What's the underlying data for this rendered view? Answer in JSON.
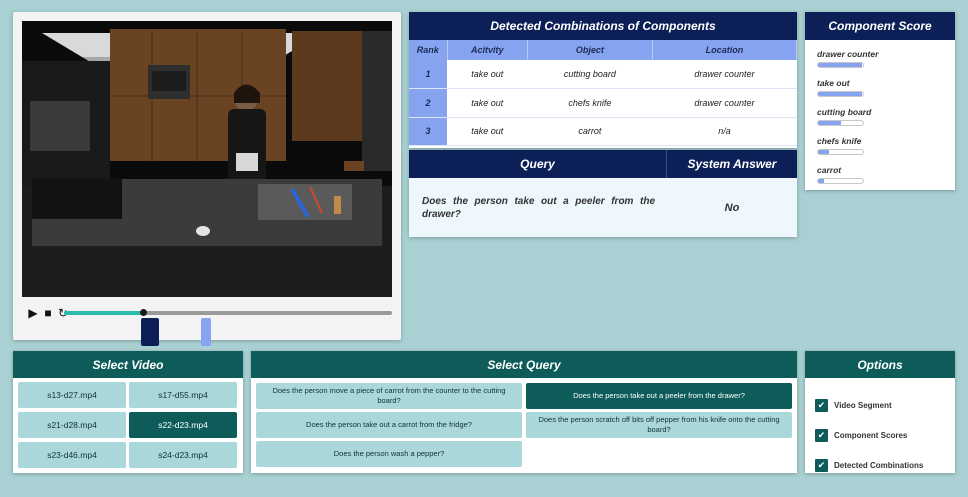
{
  "video": {
    "progress": 0.24,
    "segments": [
      "segment-a",
      "segment-b"
    ]
  },
  "combinations": {
    "title": "Detected Combinations of Components",
    "headers": {
      "rank": "Rank",
      "activity": "Acitvity",
      "object": "Object",
      "location": "Location"
    },
    "rows": [
      {
        "rank": "1",
        "activity": "take out",
        "object": "cutting board",
        "location": "drawer counter"
      },
      {
        "rank": "2",
        "activity": "take out",
        "object": "chefs knife",
        "location": "drawer counter"
      },
      {
        "rank": "3",
        "activity": "take out",
        "object": "carrot",
        "location": "n/a"
      }
    ]
  },
  "query": {
    "header_query": "Query",
    "header_answer": "System Answer",
    "text": "Does the person take out a peeler from the drawer?",
    "answer": "No"
  },
  "component_score": {
    "title": "Component Score",
    "items": [
      {
        "label": "drawer counter",
        "value": 0.97
      },
      {
        "label": "take out",
        "value": 0.97
      },
      {
        "label": "cutting board",
        "value": 0.52
      },
      {
        "label": "chefs knife",
        "value": 0.24
      },
      {
        "label": "carrot",
        "value": 0.13
      }
    ]
  },
  "select_video": {
    "title": "Select Video",
    "items": [
      "s13-d27.mp4",
      "s17-d55.mp4",
      "s21-d28.mp4",
      "s22-d23.mp4",
      "s23-d46.mp4",
      "s24-d23.mp4"
    ],
    "selected": "s22-d23.mp4"
  },
  "select_query": {
    "title": "Select Query",
    "items": [
      "Does the person move a piece of carrot from the counter to the cutting board?",
      "Does the person take out a peeler from the drawer?",
      "Does the person take out a carrot from the fridge?",
      "Does the person scratch off bits off pepper from his knife onto the cutting board?",
      "Does the person wash a pepper?"
    ],
    "selected": "Does the person take out a peeler from the drawer?"
  },
  "options": {
    "title": "Options",
    "items": [
      {
        "label": "Video Segment",
        "checked": true
      },
      {
        "label": "Component Scores",
        "checked": true
      },
      {
        "label": "Detected Combinations",
        "checked": true
      }
    ]
  },
  "colors": {
    "navy": "#0c1f57",
    "teal": "#0e5c5a",
    "periwinkle": "#86a3ef",
    "background": "#a9d0d2",
    "progress": "#2dbaa8"
  }
}
